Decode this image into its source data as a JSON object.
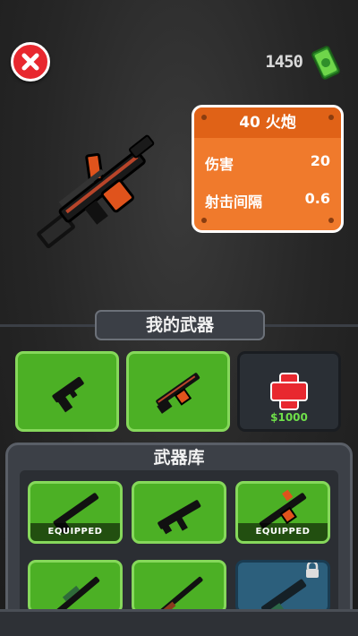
{
  "header": {
    "coins": "1450",
    "close_icon": "close-icon",
    "currency_icon": "cash-stack-icon"
  },
  "weapon_info": {
    "title": "40 火炮",
    "stats": [
      {
        "label": "伤害",
        "value": "20"
      },
      {
        "label": "射击间隔",
        "value": "0.6"
      }
    ]
  },
  "my_weapons": {
    "title": "我的武器",
    "slots": [
      {
        "icon": "pistol-icon",
        "state": "owned"
      },
      {
        "icon": "cannon-icon",
        "state": "owned"
      },
      {
        "icon": "plus-icon",
        "state": "buy",
        "price": "$1000"
      }
    ]
  },
  "armory": {
    "title": "武器库",
    "items": [
      {
        "icon": "rifle-icon",
        "badge": "EQUIPPED"
      },
      {
        "icon": "smg-icon",
        "badge": ""
      },
      {
        "icon": "cannon-icon",
        "badge": "EQUIPPED"
      },
      {
        "icon": "sniper-icon",
        "badge": ""
      },
      {
        "icon": "shotgun-icon",
        "badge": ""
      },
      {
        "icon": "minigun-icon",
        "badge": "",
        "locked": true,
        "lock_icon": "lock-icon"
      }
    ]
  },
  "colors": {
    "accent_orange": "#f07a2c",
    "tile_green": "#4cb025",
    "close_red": "#e8282f",
    "price_green": "#6fe04a"
  }
}
